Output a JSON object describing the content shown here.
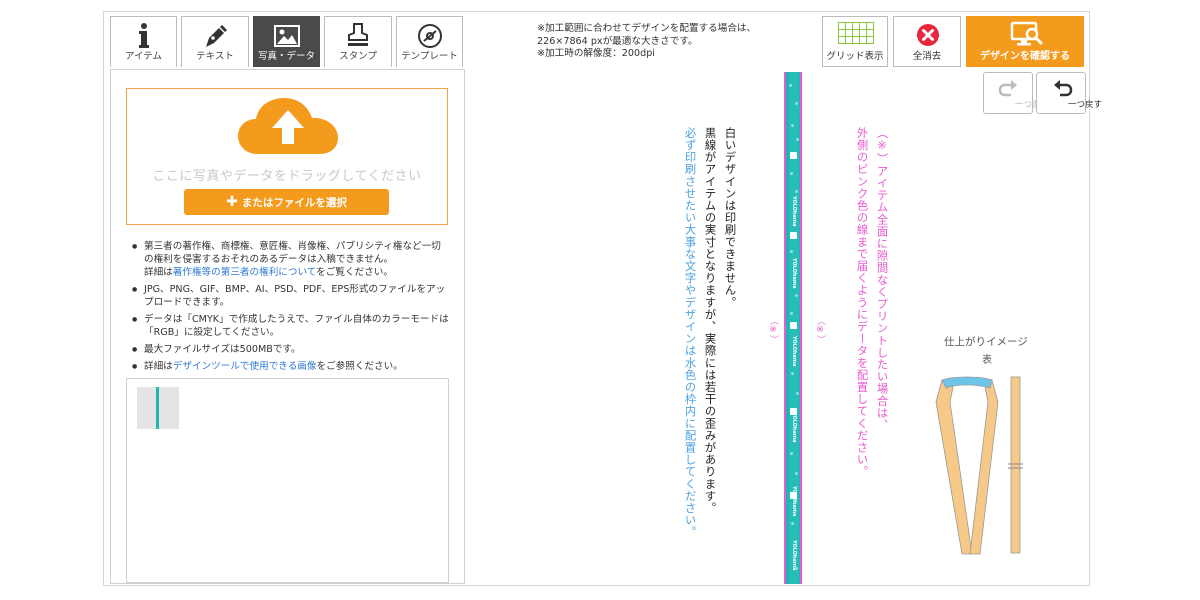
{
  "tabs": [
    {
      "label": "アイテム",
      "icon": "info-icon"
    },
    {
      "label": "テキスト",
      "icon": "pen-icon"
    },
    {
      "label": "写真・データ",
      "icon": "image-icon"
    },
    {
      "label": "スタンプ",
      "icon": "stamp-icon"
    },
    {
      "label": "テンプレート",
      "icon": "template-icon"
    }
  ],
  "upload": {
    "drop_text": "ここに写真やデータをドラッグしてください",
    "file_button": "またはファイルを選択"
  },
  "notes": {
    "n1a": "第三者の著作権、商標権、意匠権、肖像権、パブリシティ権など一切の権利を侵害するおそれのあるデータは入稿できません。",
    "n1b_prefix": "詳細は",
    "n1b_link": "著作権等の第三者の権利について",
    "n1b_suffix": "をご覧ください。",
    "n2": "JPG、PNG、GIF、BMP、AI、PSD、PDF、EPS形式のファイルをアップロードできます。",
    "n3": "データは「CMYK」で作成したうえで、ファイル自体のカラーモードは「RGB」に設定してください。",
    "n4": "最大ファイルサイズは500MBです。",
    "n5_prefix": "詳細は",
    "n5_link": "デザインツールで使用できる画像",
    "n5_suffix": "をご参照ください。"
  },
  "info": {
    "line1": "※加工範囲に合わせてデザインを配置する場合は、",
    "line2": "226×7864 pxが最適な大きさです。",
    "line3": "※加工時の解像度：200dpi"
  },
  "toolbar": {
    "grid": "グリッド表示",
    "clear": "全消去",
    "confirm": "デザインを確認する",
    "redo": "一つ進む",
    "undo": "一つ戻す"
  },
  "canvas": {
    "black_note_1": "白いデザインは印刷できません。",
    "black_note_2": "黒線がアイテムの実寸となりますが、実際には若干の歪みがあります。",
    "blue_note": "必ず印刷させたい大事な文字やデザインは水色の枠内に配置してください。",
    "pink_note_1": "（※）アイテム全面に隙間なくプリントしたい場合は、",
    "pink_note_2": "外側のピンク色の線まで届くようにデータを配置してください。",
    "kome": "（※）",
    "strip_text": "YOLOhama"
  },
  "preview": {
    "title": "仕上がりイメージ",
    "side": "表"
  },
  "colors": {
    "accent_orange": "#f49a1c",
    "strip_teal": "#1fb5b0",
    "pink_line": "#e95ad0",
    "blue_text": "#4aa3e0",
    "clear_red": "#e8263c"
  }
}
